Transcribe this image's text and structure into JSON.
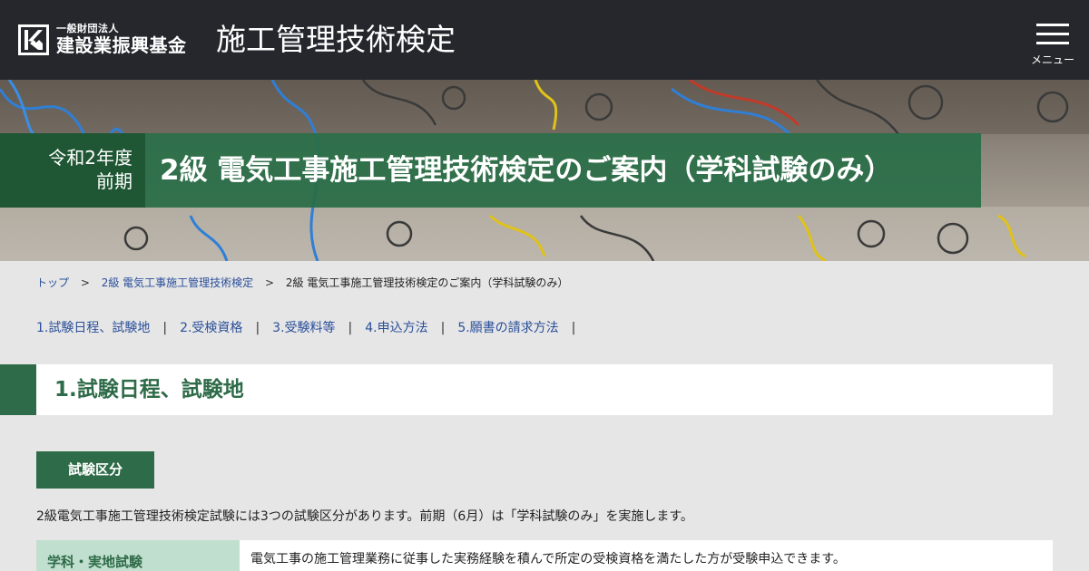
{
  "header": {
    "org_small": "一般財団法人",
    "org_name": "建設業振興基金",
    "site_title": "施工管理技術検定",
    "menu_label": "メニュー",
    "logo_icon": "kk-logo-icon",
    "menu_icon": "hamburger-menu-icon"
  },
  "hero": {
    "year": "令和2年度",
    "period": "前期",
    "title": "2級 電気工事施工管理技術検定のご案内（学科試験のみ）"
  },
  "breadcrumb": {
    "items": [
      "トップ",
      "2級 電気工事施工管理技術検定",
      "2級 電気工事施工管理技術検定のご案内（学科試験のみ）"
    ],
    "separator": ">"
  },
  "anchor_nav": {
    "items": [
      "1.試験日程、試験地",
      "2.受検資格",
      "3.受験料等",
      "4.申込方法",
      "5.願書の請求方法"
    ],
    "separator": "|"
  },
  "section": {
    "heading": "1.試験日程、試験地",
    "tab_label": "試験区分",
    "intro": "2級電気工事施工管理技術検定試験には3つの試験区分があります。前期（6月）は「学科試験のみ」を実施します。",
    "rows": [
      {
        "label": "学科・実地試験",
        "text": "電気工事の施工管理業務に従事した実務経験を積んで所定の受検資格を満たした方が受験申込できます。"
      }
    ]
  },
  "colors": {
    "header_bg": "#25272c",
    "brand_green": "#2e6b48",
    "dark_green": "#1f5634",
    "light_green": "#c0dfce",
    "link_blue": "#2a4f9a",
    "page_bg": "#e6e6e6"
  }
}
